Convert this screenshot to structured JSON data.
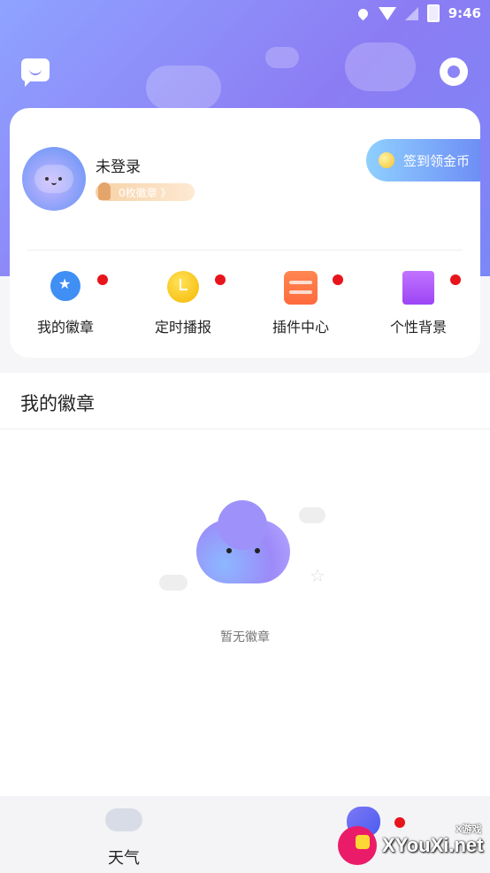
{
  "status_bar": {
    "time": "9:46"
  },
  "profile": {
    "login_status": "未登录",
    "badge_count": "0枚徽章 》",
    "checkin_label": "签到领金币"
  },
  "quick_actions": [
    {
      "label": "我的徽章",
      "icon": "badge-icon"
    },
    {
      "label": "定时播报",
      "icon": "clock-icon"
    },
    {
      "label": "插件中心",
      "icon": "plugin-icon"
    },
    {
      "label": "个性背景",
      "icon": "shirt-icon"
    }
  ],
  "badges_section": {
    "title": "我的徽章",
    "empty_text": "暂无徽章"
  },
  "bottom_nav": {
    "weather_label": "天气"
  },
  "watermark": {
    "text": "XYouXi.net",
    "sub": "X游戏"
  },
  "colors": {
    "header_gradient_start": "#8fa3ff",
    "header_gradient_end": "#7b88f7",
    "accent_red_dot": "#e8141b",
    "checkin_gradient": "#6e8ef5"
  }
}
